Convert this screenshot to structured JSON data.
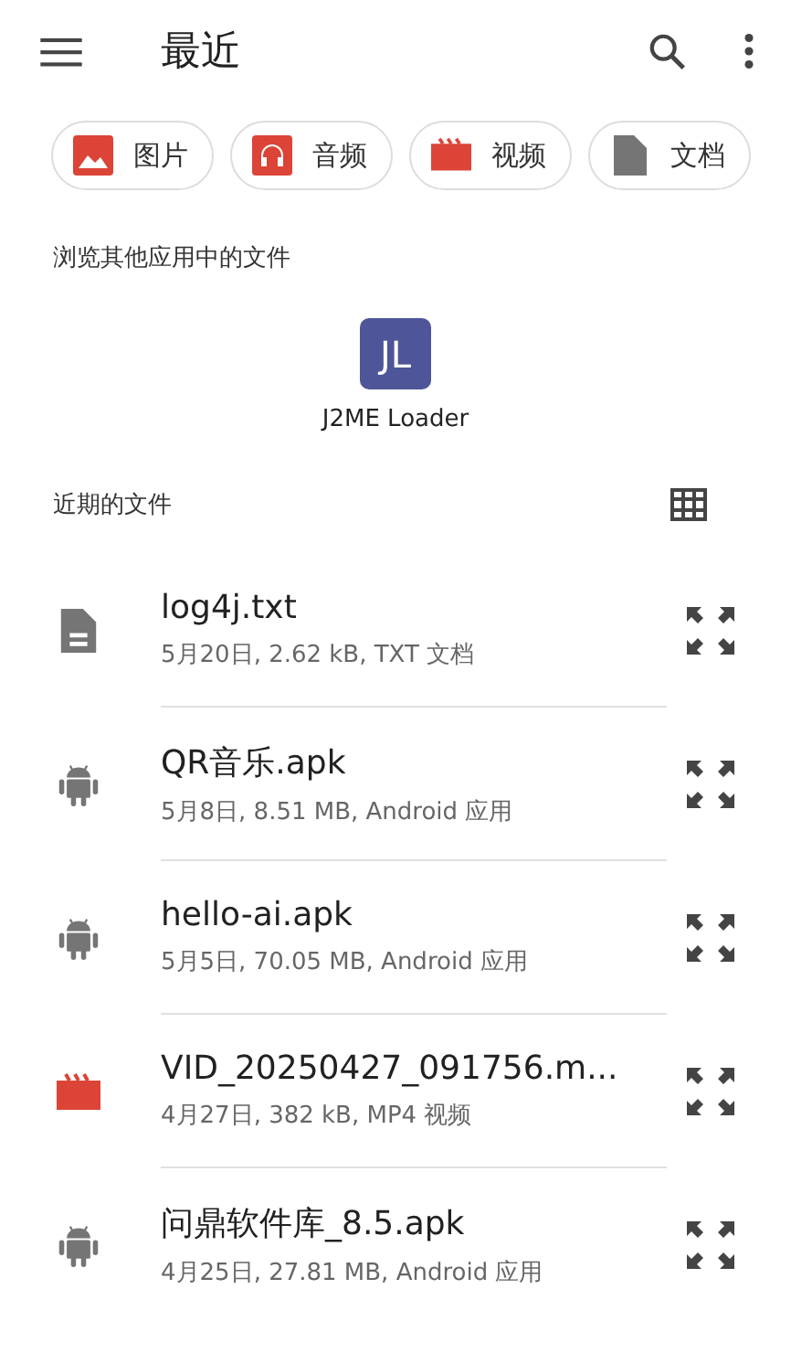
{
  "app_bar": {
    "title": "最近"
  },
  "chips": [
    {
      "label": "图片",
      "kind": "image"
    },
    {
      "label": "音频",
      "kind": "audio"
    },
    {
      "label": "视频",
      "kind": "video"
    },
    {
      "label": "文档",
      "kind": "document"
    }
  ],
  "other_apps": {
    "heading": "浏览其他应用中的文件",
    "apps": [
      {
        "name": "J2ME Loader",
        "logo": "JL"
      }
    ]
  },
  "recent": {
    "heading": "近期的文件"
  },
  "files": [
    {
      "name": "log4j.txt",
      "details": "5月20日, 2.62 kB, TXT 文档",
      "kind": "document"
    },
    {
      "name": "QR音乐.apk",
      "details": "5月8日, 8.51 MB, Android 应用",
      "kind": "android"
    },
    {
      "name": "hello-ai.apk",
      "details": "5月5日, 70.05 MB, Android 应用",
      "kind": "android"
    },
    {
      "name": "VID_20250427_091756.m...",
      "details": "4月27日, 382 kB, MP4 视频",
      "kind": "video"
    },
    {
      "name": "问鼎软件库_8.5.apk",
      "details": "4月25日, 27.81 MB, Android 应用",
      "kind": "android"
    }
  ]
}
